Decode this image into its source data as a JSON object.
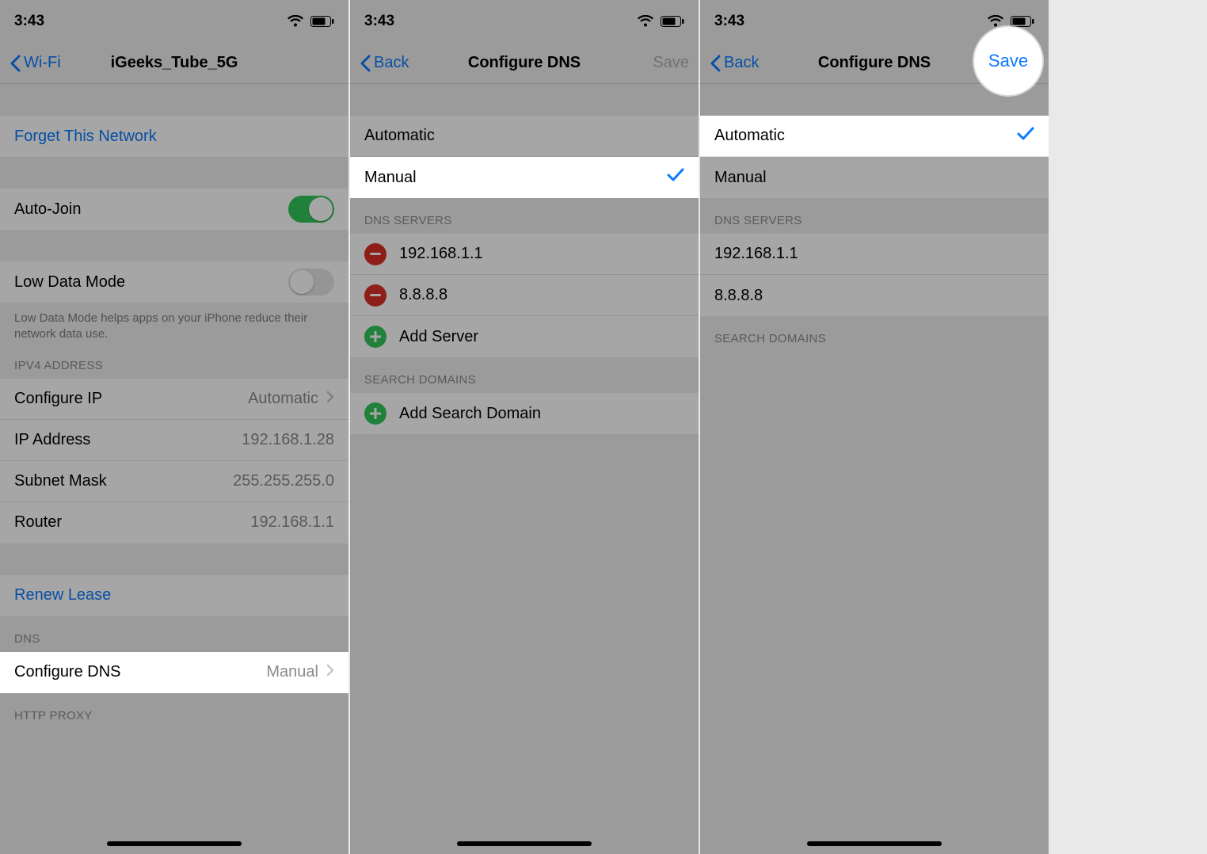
{
  "status": {
    "time": "3:43"
  },
  "panel1": {
    "nav": {
      "back": "Wi-Fi",
      "title": "iGeeks_Tube_5G"
    },
    "forget": "Forget This Network",
    "autojoin_label": "Auto-Join",
    "lowdata_label": "Low Data Mode",
    "lowdata_note": "Low Data Mode helps apps on your iPhone reduce their network data use.",
    "ipv4_header": "IPV4 ADDRESS",
    "configure_ip_label": "Configure IP",
    "configure_ip_value": "Automatic",
    "ip_label": "IP Address",
    "ip_value": "192.168.1.28",
    "subnet_label": "Subnet Mask",
    "subnet_value": "255.255.255.0",
    "router_label": "Router",
    "router_value": "192.168.1.1",
    "renew": "Renew Lease",
    "dns_header": "DNS",
    "configure_dns_label": "Configure DNS",
    "configure_dns_value": "Manual",
    "http_proxy_header": "HTTP PROXY"
  },
  "panel2": {
    "nav": {
      "back": "Back",
      "title": "Configure DNS",
      "save": "Save"
    },
    "automatic": "Automatic",
    "manual": "Manual",
    "dns_header": "DNS SERVERS",
    "servers": [
      "192.168.1.1",
      "8.8.8.8"
    ],
    "add_server": "Add Server",
    "search_header": "SEARCH DOMAINS",
    "add_domain": "Add Search Domain"
  },
  "panel3": {
    "nav": {
      "back": "Back",
      "title": "Configure DNS",
      "save": "Save"
    },
    "automatic": "Automatic",
    "manual": "Manual",
    "dns_header": "DNS SERVERS",
    "servers": [
      "192.168.1.1",
      "8.8.8.8"
    ],
    "search_header": "SEARCH DOMAINS"
  }
}
